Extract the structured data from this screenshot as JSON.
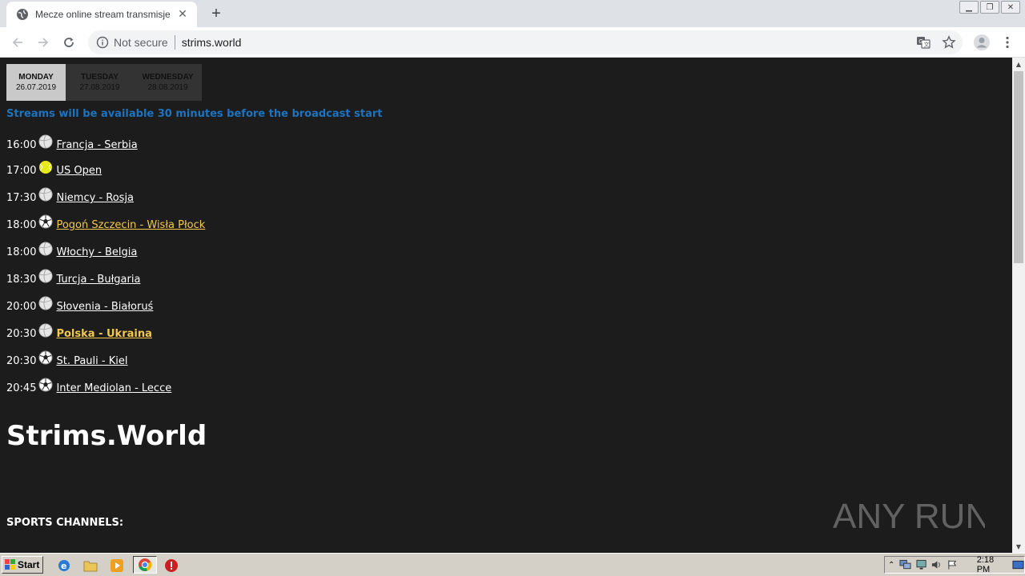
{
  "browser": {
    "tab_title": "Mecze online stream transmisje sport",
    "tab_close": "✕",
    "new_tab": "+",
    "security_label": "Not secure",
    "url": "strims.world"
  },
  "page": {
    "days": [
      {
        "name": "MONDAY",
        "date": "26.07.2019",
        "active": true
      },
      {
        "name": "TUESDAY",
        "date": "27.08.2019",
        "active": false
      },
      {
        "name": "WEDNESDAY",
        "date": "28.08.2019",
        "active": false
      }
    ],
    "notice": "Streams will be available 30 minutes before the broadcast start",
    "matches": [
      {
        "time": "16:00",
        "sport": "volleyball",
        "title": "Francja - Serbia",
        "highlight": false,
        "bold": false
      },
      {
        "time": "17:00",
        "sport": "tennis",
        "title": "US Open",
        "highlight": false,
        "bold": false
      },
      {
        "time": "17:30",
        "sport": "volleyball",
        "title": "Niemcy - Rosja",
        "highlight": false,
        "bold": false
      },
      {
        "time": "18:00",
        "sport": "football",
        "title": "Pogoń Szczecin - Wisła Płock",
        "highlight": true,
        "bold": false
      },
      {
        "time": "18:00",
        "sport": "volleyball",
        "title": "Włochy - Belgia",
        "highlight": false,
        "bold": false
      },
      {
        "time": "18:30",
        "sport": "volleyball",
        "title": "Turcja - Bułgaria",
        "highlight": false,
        "bold": false
      },
      {
        "time": "20:00",
        "sport": "volleyball",
        "title": "Słovenia - Białoruś",
        "highlight": false,
        "bold": false
      },
      {
        "time": "20:30",
        "sport": "volleyball",
        "title": "Polska - Ukraina",
        "highlight": true,
        "bold": true
      },
      {
        "time": "20:30",
        "sport": "football",
        "title": "St. Pauli - Kiel",
        "highlight": false,
        "bold": false
      },
      {
        "time": "20:45",
        "sport": "football",
        "title": "Inter Mediolan - Lecce",
        "highlight": false,
        "bold": false
      }
    ],
    "site_title": "Strims.World",
    "channels_heading": "SPORTS CHANNELS:",
    "watermark": "ANY RUN"
  },
  "taskbar": {
    "start_label": "Start",
    "clock": "2:18 PM"
  },
  "colors": {
    "page_bg": "#1c1c1c",
    "notice": "#1e73be",
    "highlight_link": "#f2c94c"
  }
}
